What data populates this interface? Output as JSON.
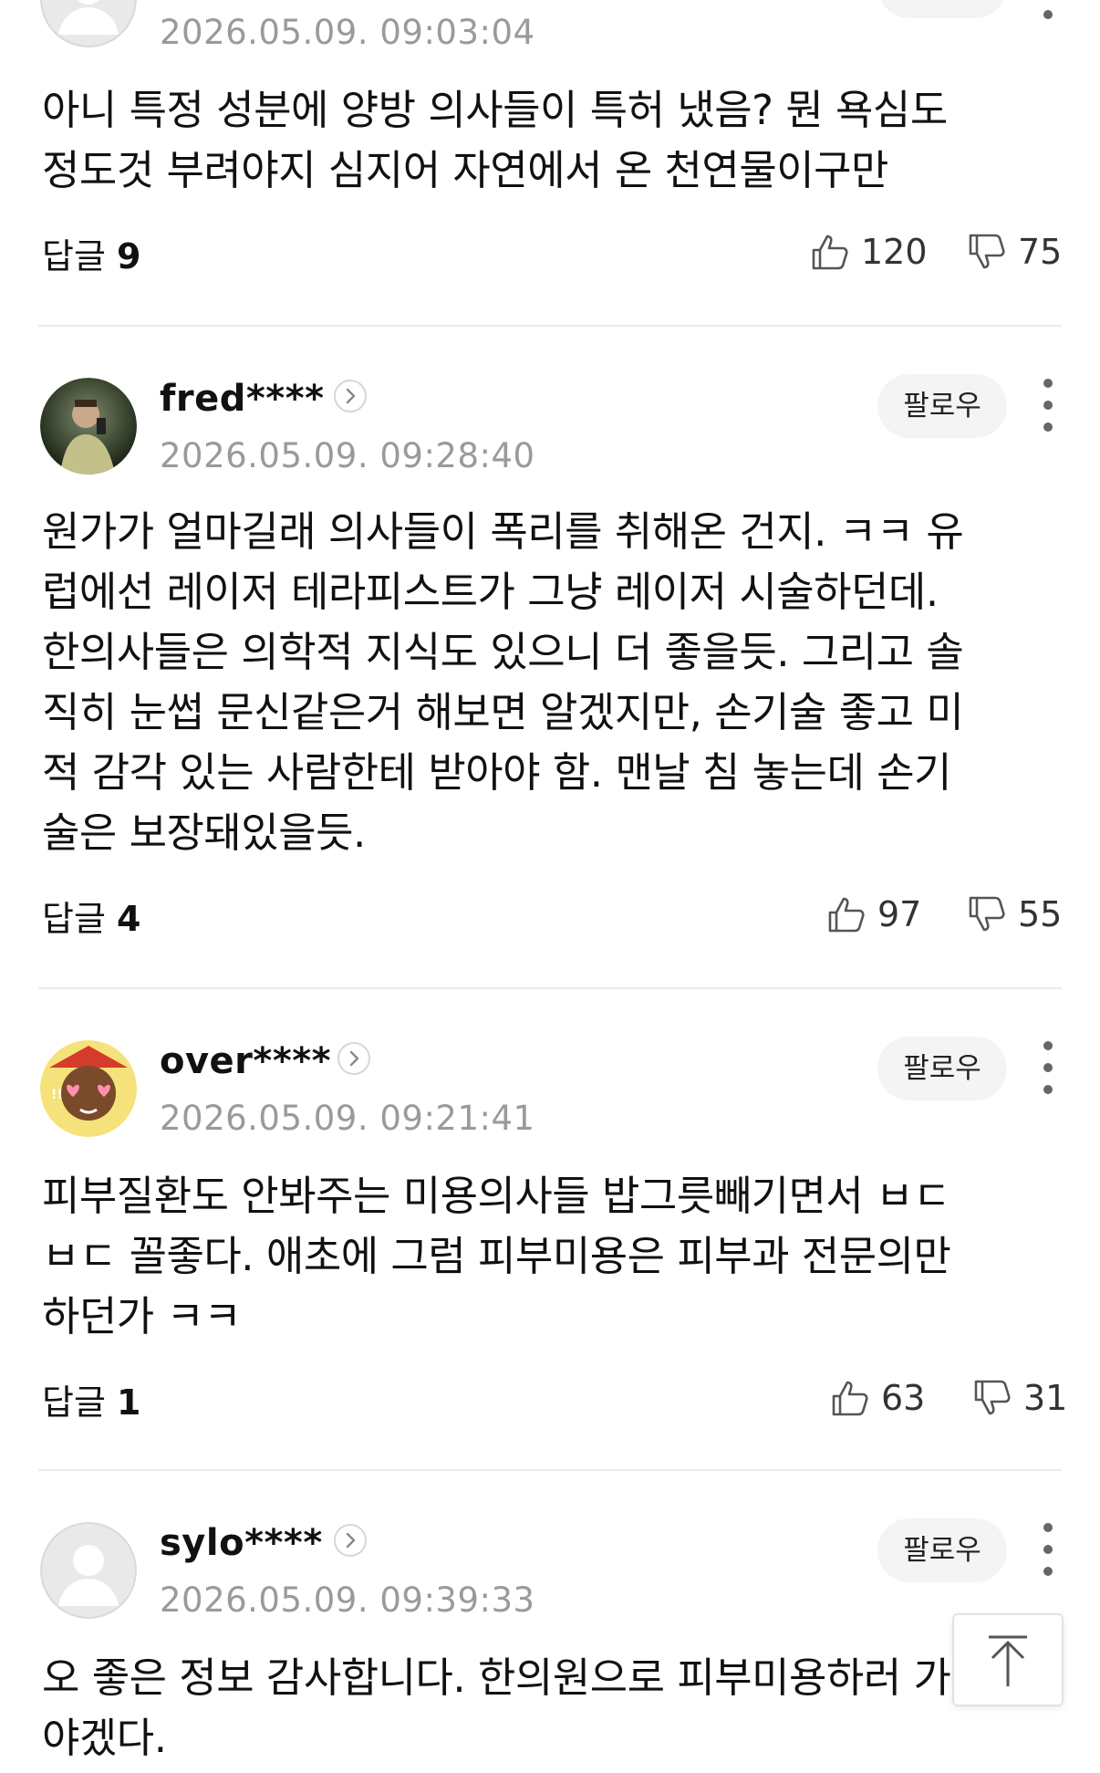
{
  "comments": [
    {
      "nickname": "",
      "date": "2026.05.09. 09:03:04",
      "text": "아니 특정 성분에 양방 의사들이 특허 냈음? 뭔 욕심도\n정도것 부려야지 심지어 자연에서 온 천연물이구만",
      "replies_label": "답글",
      "replies_count": "9",
      "likes": "120",
      "dislikes": "75"
    },
    {
      "nickname": "fred****",
      "date": "2026.05.09. 09:28:40",
      "follow_label": "팔로우",
      "text": "원가가 얼마길래 의사들이 폭리를 취해온 건지. ㅋㅋ 유\n럽에선 레이저 테라피스트가 그냥 레이저 시술하던데.\n한의사들은 의학적 지식도 있으니 더 좋을듯. 그리고 솔\n직히 눈썹 문신같은거 해보면 알겠지만, 손기술 좋고 미\n적 감각 있는 사람한테 받아야 함. 맨날 침 놓는데 손기\n술은 보장돼있을듯.",
      "replies_label": "답글",
      "replies_count": "4",
      "likes": "97",
      "dislikes": "55"
    },
    {
      "nickname": "over****",
      "date": "2026.05.09. 09:21:41",
      "follow_label": "팔로우",
      "text": "피부질환도 안봐주는 미용의사들 밥그릇빼기면서 ㅂㄷ\nㅂㄷ 꼴좋다. 애초에 그럼 피부미용은 피부과 전문의만\n하던가 ㅋㅋ",
      "replies_label": "답글",
      "replies_count": "1",
      "likes": "63",
      "dislikes": "31"
    },
    {
      "nickname": "sylo****",
      "date": "2026.05.09. 09:39:33",
      "follow_label": "팔로우",
      "text": "오 좋은 정보 감사합니다. 한의원으로 피부미용하러 가\n야겠다."
    }
  ],
  "icons": {
    "like": "thumbs-up-icon",
    "dislike": "thumbs-down-icon",
    "more": "kebab-menu-icon",
    "profile": "chevron-right-icon",
    "scroll_top": "arrow-up-icon"
  },
  "colors": {
    "date": "#9a9a9a",
    "divider": "#ececec",
    "follow_bg": "#f4f4f4"
  }
}
